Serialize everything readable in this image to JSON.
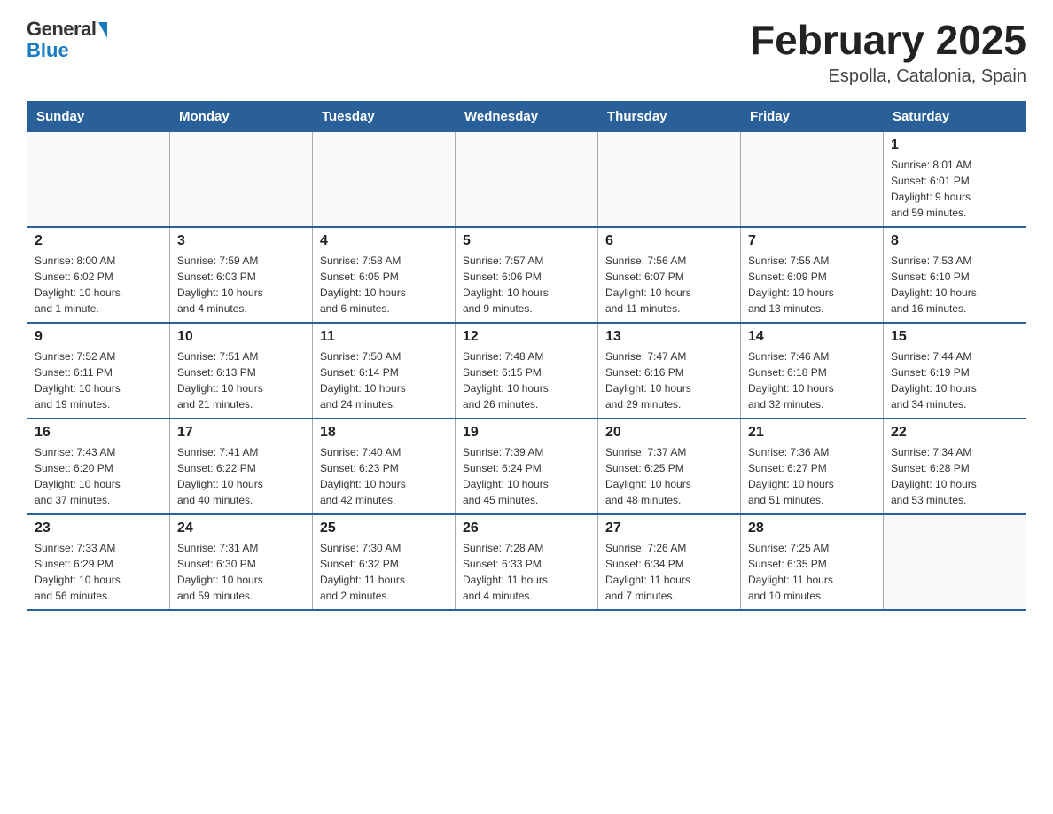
{
  "header": {
    "logo": {
      "general": "General",
      "blue": "Blue"
    },
    "title": "February 2025",
    "location": "Espolla, Catalonia, Spain"
  },
  "days_of_week": [
    "Sunday",
    "Monday",
    "Tuesday",
    "Wednesday",
    "Thursday",
    "Friday",
    "Saturday"
  ],
  "weeks": [
    [
      {
        "day": "",
        "info": ""
      },
      {
        "day": "",
        "info": ""
      },
      {
        "day": "",
        "info": ""
      },
      {
        "day": "",
        "info": ""
      },
      {
        "day": "",
        "info": ""
      },
      {
        "day": "",
        "info": ""
      },
      {
        "day": "1",
        "info": "Sunrise: 8:01 AM\nSunset: 6:01 PM\nDaylight: 9 hours\nand 59 minutes."
      }
    ],
    [
      {
        "day": "2",
        "info": "Sunrise: 8:00 AM\nSunset: 6:02 PM\nDaylight: 10 hours\nand 1 minute."
      },
      {
        "day": "3",
        "info": "Sunrise: 7:59 AM\nSunset: 6:03 PM\nDaylight: 10 hours\nand 4 minutes."
      },
      {
        "day": "4",
        "info": "Sunrise: 7:58 AM\nSunset: 6:05 PM\nDaylight: 10 hours\nand 6 minutes."
      },
      {
        "day": "5",
        "info": "Sunrise: 7:57 AM\nSunset: 6:06 PM\nDaylight: 10 hours\nand 9 minutes."
      },
      {
        "day": "6",
        "info": "Sunrise: 7:56 AM\nSunset: 6:07 PM\nDaylight: 10 hours\nand 11 minutes."
      },
      {
        "day": "7",
        "info": "Sunrise: 7:55 AM\nSunset: 6:09 PM\nDaylight: 10 hours\nand 13 minutes."
      },
      {
        "day": "8",
        "info": "Sunrise: 7:53 AM\nSunset: 6:10 PM\nDaylight: 10 hours\nand 16 minutes."
      }
    ],
    [
      {
        "day": "9",
        "info": "Sunrise: 7:52 AM\nSunset: 6:11 PM\nDaylight: 10 hours\nand 19 minutes."
      },
      {
        "day": "10",
        "info": "Sunrise: 7:51 AM\nSunset: 6:13 PM\nDaylight: 10 hours\nand 21 minutes."
      },
      {
        "day": "11",
        "info": "Sunrise: 7:50 AM\nSunset: 6:14 PM\nDaylight: 10 hours\nand 24 minutes."
      },
      {
        "day": "12",
        "info": "Sunrise: 7:48 AM\nSunset: 6:15 PM\nDaylight: 10 hours\nand 26 minutes."
      },
      {
        "day": "13",
        "info": "Sunrise: 7:47 AM\nSunset: 6:16 PM\nDaylight: 10 hours\nand 29 minutes."
      },
      {
        "day": "14",
        "info": "Sunrise: 7:46 AM\nSunset: 6:18 PM\nDaylight: 10 hours\nand 32 minutes."
      },
      {
        "day": "15",
        "info": "Sunrise: 7:44 AM\nSunset: 6:19 PM\nDaylight: 10 hours\nand 34 minutes."
      }
    ],
    [
      {
        "day": "16",
        "info": "Sunrise: 7:43 AM\nSunset: 6:20 PM\nDaylight: 10 hours\nand 37 minutes."
      },
      {
        "day": "17",
        "info": "Sunrise: 7:41 AM\nSunset: 6:22 PM\nDaylight: 10 hours\nand 40 minutes."
      },
      {
        "day": "18",
        "info": "Sunrise: 7:40 AM\nSunset: 6:23 PM\nDaylight: 10 hours\nand 42 minutes."
      },
      {
        "day": "19",
        "info": "Sunrise: 7:39 AM\nSunset: 6:24 PM\nDaylight: 10 hours\nand 45 minutes."
      },
      {
        "day": "20",
        "info": "Sunrise: 7:37 AM\nSunset: 6:25 PM\nDaylight: 10 hours\nand 48 minutes."
      },
      {
        "day": "21",
        "info": "Sunrise: 7:36 AM\nSunset: 6:27 PM\nDaylight: 10 hours\nand 51 minutes."
      },
      {
        "day": "22",
        "info": "Sunrise: 7:34 AM\nSunset: 6:28 PM\nDaylight: 10 hours\nand 53 minutes."
      }
    ],
    [
      {
        "day": "23",
        "info": "Sunrise: 7:33 AM\nSunset: 6:29 PM\nDaylight: 10 hours\nand 56 minutes."
      },
      {
        "day": "24",
        "info": "Sunrise: 7:31 AM\nSunset: 6:30 PM\nDaylight: 10 hours\nand 59 minutes."
      },
      {
        "day": "25",
        "info": "Sunrise: 7:30 AM\nSunset: 6:32 PM\nDaylight: 11 hours\nand 2 minutes."
      },
      {
        "day": "26",
        "info": "Sunrise: 7:28 AM\nSunset: 6:33 PM\nDaylight: 11 hours\nand 4 minutes."
      },
      {
        "day": "27",
        "info": "Sunrise: 7:26 AM\nSunset: 6:34 PM\nDaylight: 11 hours\nand 7 minutes."
      },
      {
        "day": "28",
        "info": "Sunrise: 7:25 AM\nSunset: 6:35 PM\nDaylight: 11 hours\nand 10 minutes."
      },
      {
        "day": "",
        "info": ""
      }
    ]
  ]
}
